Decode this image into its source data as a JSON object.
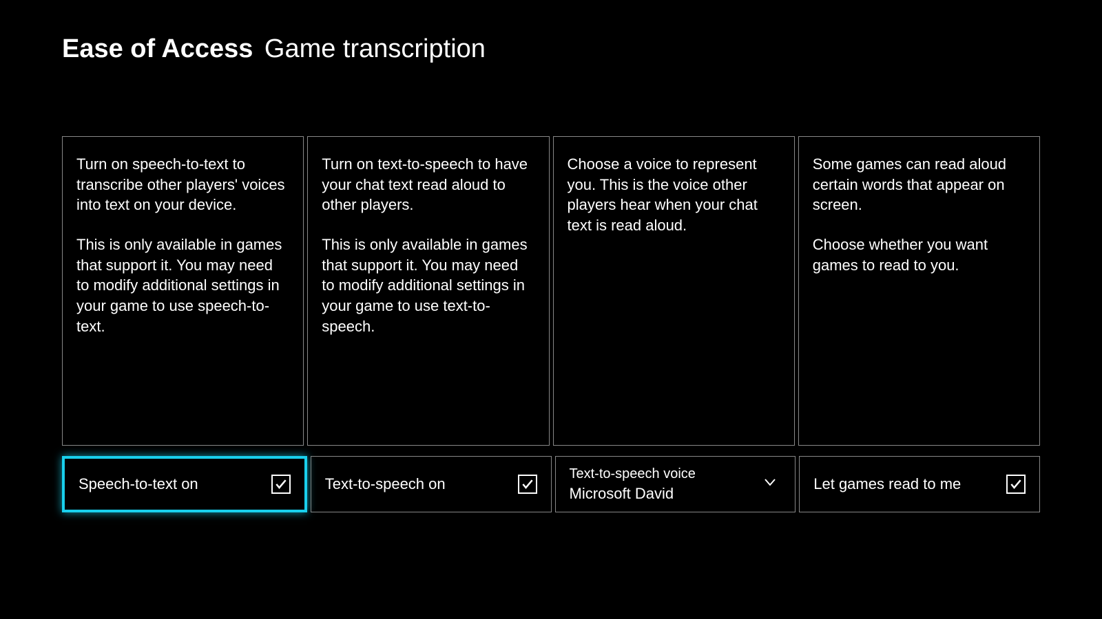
{
  "header": {
    "title": "Ease of Access",
    "subtitle": "Game transcription"
  },
  "cards": [
    {
      "p1": "Turn on speech-to-text to transcribe other players' voices into text on your device.",
      "p2": "This is only available in games that support it. You may need to modify additional settings in your game to use speech-to-text."
    },
    {
      "p1": "Turn on text-to-speech to have your chat text read aloud to other players.",
      "p2": "This is only available in games that support it. You may need to modify additional settings in your game to use text-to-speech."
    },
    {
      "p1": "Choose a voice to represent you. This is the voice other players hear when your chat text is read aloud.",
      "p2": ""
    },
    {
      "p1": "Some games can read aloud certain words that appear on screen.",
      "p2": "Choose whether you want games to read to you."
    }
  ],
  "controls": {
    "speechToText": {
      "label": "Speech-to-text on",
      "checked": true,
      "selected": true
    },
    "textToSpeech": {
      "label": "Text-to-speech on",
      "checked": true
    },
    "voice": {
      "label": "Text-to-speech voice",
      "value": "Microsoft David"
    },
    "readToMe": {
      "label": "Let games read to me",
      "checked": true
    }
  }
}
